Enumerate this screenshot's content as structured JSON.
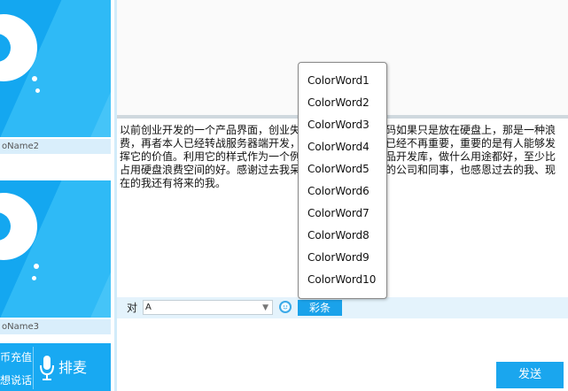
{
  "left_panel": {
    "tiles": [
      {
        "name": "oName2"
      },
      {
        "name": "oName3"
      }
    ],
    "buttons": {
      "recharge_label": "币充值",
      "speak_label": "想说话",
      "queue_label": "排麦"
    }
  },
  "chat": {
    "message": "以前创业开发的一个产品界面，创业失败后，这么好的代码如果只是放在硬盘上，那是一种浪费，再者本人已经转战服务器端开发，界面库，对我来说已经不再重要，重要的是有人能够发挥它的价值。利用它的样式作为一个例子又或作为一个产品开发库，做什么用途都好，至少比占用硬盘浪费空间的好。感谢过去我呆过和现在正在工作的公司和同事，也感恩过去的我、现在的我还有将来的我。"
  },
  "toolbar": {
    "to_label": "对",
    "target_value": "A",
    "color_button_label": "彩条"
  },
  "input": {
    "send_label": "发送"
  },
  "color_menu": {
    "items": [
      "ColorWord1",
      "ColorWord2",
      "ColorWord3",
      "ColorWord4",
      "ColorWord5",
      "ColorWord6",
      "ColorWord7",
      "ColorWord8",
      "ColorWord9",
      "ColorWord10"
    ]
  },
  "colors": {
    "accent": "#1aa6ee",
    "tile_background": "#14a7f0",
    "toolbar_background": "#e4f3fc"
  }
}
